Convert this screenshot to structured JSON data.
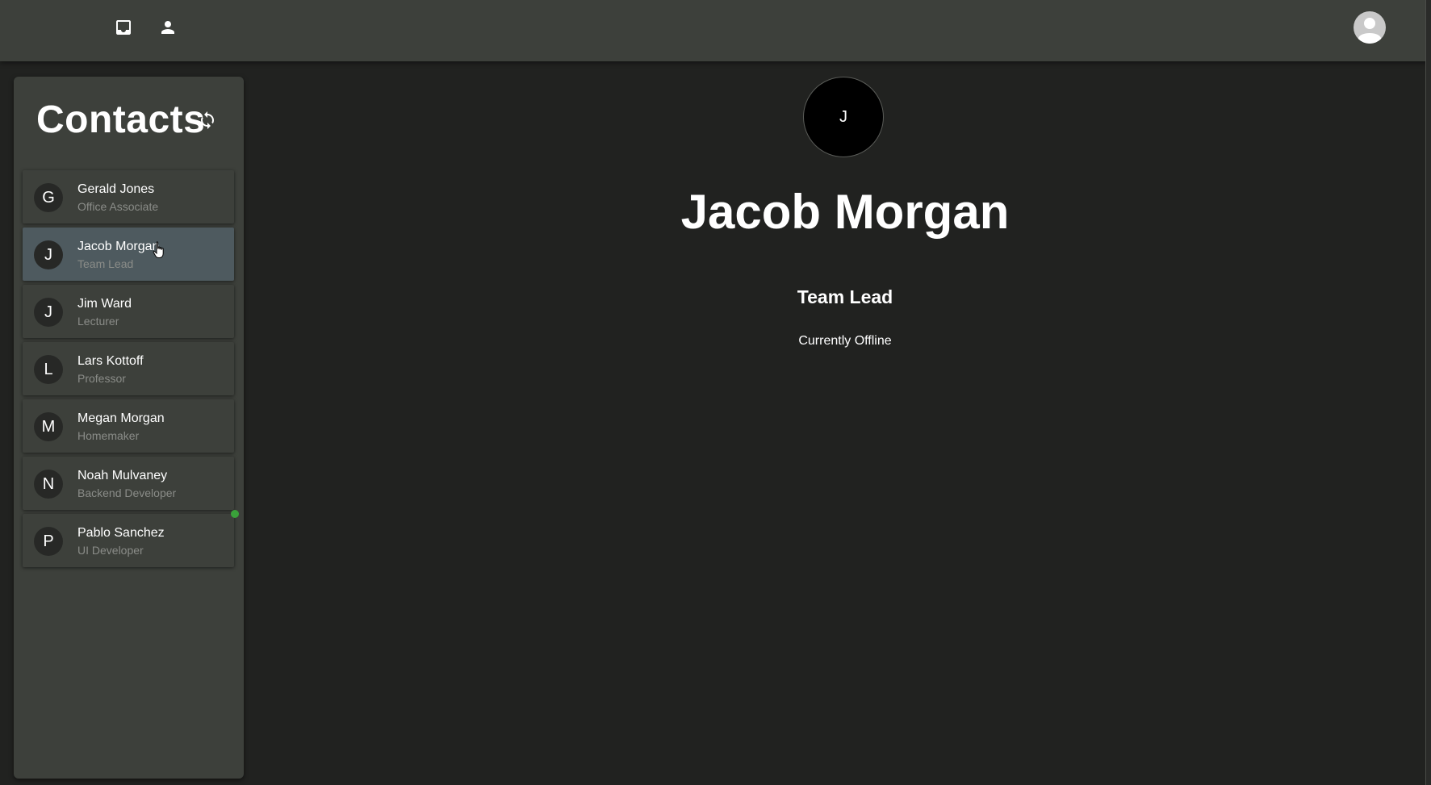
{
  "topbar": {
    "icons": [
      "inbox-icon",
      "person-icon",
      "account-circle-icon"
    ]
  },
  "sidebar": {
    "title": "Contacts",
    "refresh_icon": "refresh-icon",
    "contacts": [
      {
        "initial": "G",
        "name": "Gerald Jones",
        "role": "Office Associate",
        "selected": false
      },
      {
        "initial": "J",
        "name": "Jacob Morgan",
        "role": "Team Lead",
        "selected": true
      },
      {
        "initial": "J",
        "name": "Jim Ward",
        "role": "Lecturer",
        "selected": false
      },
      {
        "initial": "L",
        "name": "Lars Kottoff",
        "role": "Professor",
        "selected": false
      },
      {
        "initial": "M",
        "name": "Megan Morgan",
        "role": "Homemaker",
        "selected": false
      },
      {
        "initial": "N",
        "name": "Noah Mulvaney",
        "role": "Backend Developer",
        "selected": false,
        "online": true
      },
      {
        "initial": "P",
        "name": "Pablo Sanchez",
        "role": "UI Developer",
        "selected": false
      }
    ]
  },
  "detail": {
    "initial": "J",
    "name": "Jacob Morgan",
    "role": "Team Lead",
    "status": "Currently Offline"
  },
  "colors": {
    "background": "#212220",
    "panel": "#3d403b",
    "selected": "#4e5a5f",
    "online": "#3aa13a",
    "secondary_text": "#8a8c88"
  }
}
